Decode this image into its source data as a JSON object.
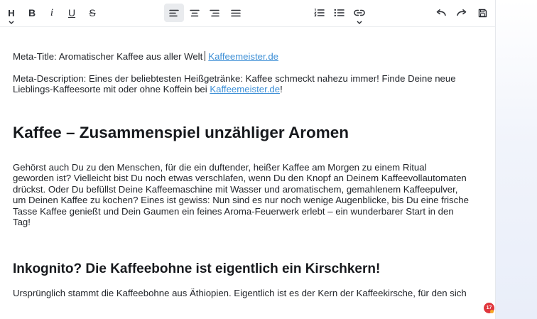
{
  "toolbar": {
    "heading_label": "H",
    "bold_label": "B",
    "italic_label": "i",
    "underline_label": "U",
    "strikethrough_label": "S"
  },
  "document": {
    "meta_title_prefix": "Meta-Title: Aromatischer Kaffee aus aller Welt",
    "meta_title_link": "Kaffeemeister.de",
    "meta_description_prefix": "Meta-Description: Eines der beliebtesten Heißgetränke: Kaffee schmeckt nahezu immer! Finde Deine neue Lieblings-Kaffeesorte mit oder ohne Koffein bei ",
    "meta_description_link": "Kaffeemeister.de",
    "meta_description_suffix": "!",
    "heading1": "Kaffee – Zusammenspiel unzähliger Aromen",
    "paragraph1_lines": [
      "Gehörst auch Du zu den Menschen, für die ein duftender, heißer Kaffee am Morgen zu einem Ritual",
      "geworden ist? Vielleicht bist Du noch etwas verschlafen, wenn Du den Knopf an Deinem Kaffeevollautomaten",
      "drückst. Oder Du befüllst Deine Kaffeemaschine mit Wasser und aromatischem, gemahlenem Kaffeepulver,",
      "um Deinen Kaffee zu kochen? Eines ist gewiss: Nun sind es nur noch wenige Augenblicke, bis Du eine frische",
      "Tasse Kaffee genießt und Dein Gaumen ein feines Aroma-Feuerwerk erlebt – ein wunderbarer Start in den",
      "Tag!"
    ],
    "heading2": "Inkognito? Die Kaffeebohne ist eigentlich ein Kirschkern!",
    "paragraph2_line": "Ursprünglich stammt die Kaffeebohne aus Äthiopien. Eigentlich ist es der Kern der Kaffeekirsche, für den sich"
  },
  "notification": {
    "count": "17"
  },
  "colors": {
    "link": "#3d8fd6",
    "active_button_bg": "#e9ebee",
    "badge": "#e0363c"
  },
  "icons": [
    "heading-icon",
    "bold-icon",
    "italic-icon",
    "underline-icon",
    "strikethrough-icon",
    "align-left-icon",
    "align-center-icon",
    "align-right-icon",
    "align-justify-icon",
    "ordered-list-icon",
    "bullet-list-icon",
    "link-icon",
    "undo-icon",
    "redo-icon",
    "save-icon"
  ]
}
